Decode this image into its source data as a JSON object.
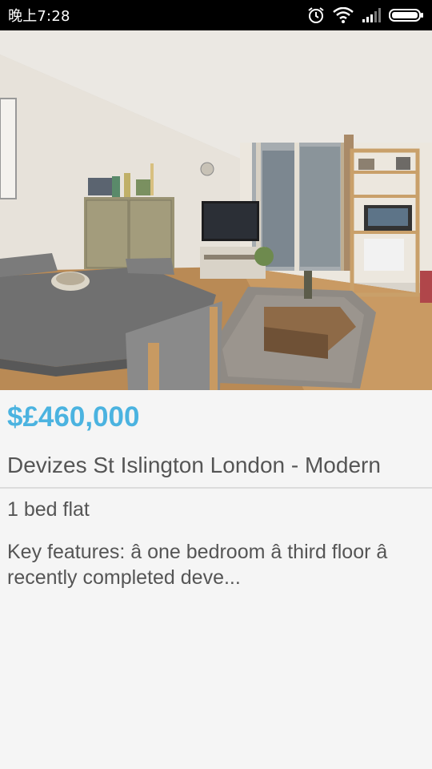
{
  "status_bar": {
    "time": "晚上7:28",
    "icons": [
      "alarm-icon",
      "wifi-icon",
      "signal-icon",
      "battery-icon"
    ]
  },
  "listing": {
    "photo_description": "living-room-photo",
    "price": "$£460,000",
    "title": "Devizes St Islington London - Modern",
    "type": "1 bed flat",
    "description": "Key features: â one bedroom â third floor â recently completed deve..."
  },
  "colors": {
    "price": "#4bb3e0",
    "text": "#555555",
    "background": "#f5f5f5",
    "status_bar": "#000000"
  }
}
